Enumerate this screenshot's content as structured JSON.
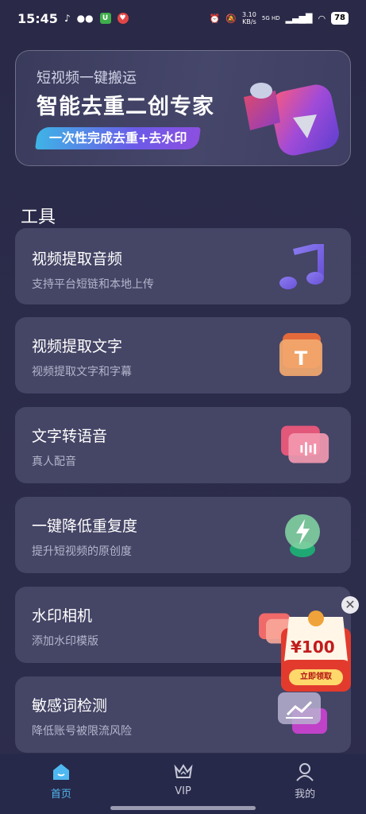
{
  "status": {
    "time": "15:45",
    "net_speed_value": "3.10",
    "net_speed_unit": "KB/s",
    "network": "5G HD",
    "battery": "78"
  },
  "banner": {
    "subtitle": "短视频一键搬运",
    "title": "智能去重二创专家",
    "pill": "一次性完成去重+去水印"
  },
  "tools_title": "工具",
  "tools": [
    {
      "title": "视频提取音频",
      "desc": "支持平台短链和本地上传",
      "icon": "music-note-icon"
    },
    {
      "title": "视频提取文字",
      "desc": "视频提取文字和字幕",
      "icon": "text-t-icon"
    },
    {
      "title": "文字转语音",
      "desc": "真人配音",
      "icon": "voice-wave-icon"
    },
    {
      "title": "一键降低重复度",
      "desc": "提升短视频的原创度",
      "icon": "lightning-icon"
    },
    {
      "title": "水印相机",
      "desc": "添加水印模版",
      "icon": "camera-icon"
    },
    {
      "title": "敏感词检测",
      "desc": "降低账号被限流风险",
      "icon": "chart-line-icon"
    }
  ],
  "promo": {
    "amount": "¥100",
    "button": "立即领取",
    "close": "✕"
  },
  "tabbar": [
    {
      "label": "首页",
      "icon": "home-icon",
      "active": true
    },
    {
      "label": "VIP",
      "icon": "crown-icon",
      "active": false
    },
    {
      "label": "我的",
      "icon": "user-icon",
      "active": false
    }
  ],
  "colors": {
    "accent": "#4fb8f0",
    "card_bg": "#454566",
    "page_bg": "#2b2b4a",
    "promo_red": "#e23b2e"
  }
}
